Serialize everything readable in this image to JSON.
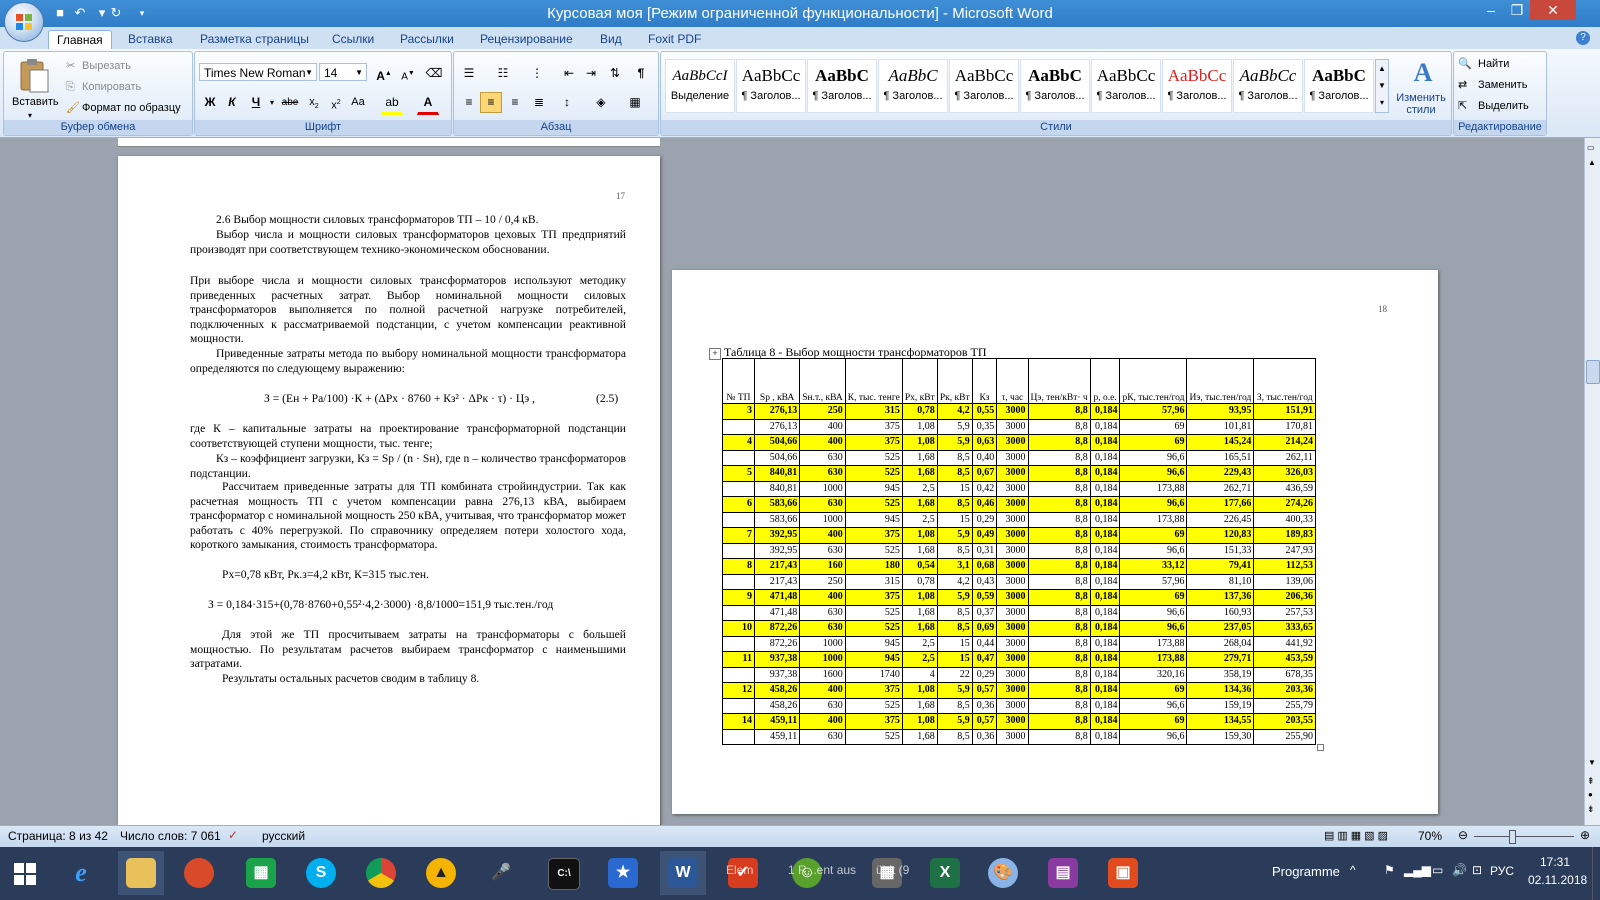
{
  "window": {
    "title": "Курсовая моя [Режим ограниченной функциональности] - Microsoft Word"
  },
  "tabs": [
    "Главная",
    "Вставка",
    "Разметка страницы",
    "Ссылки",
    "Рассылки",
    "Рецензирование",
    "Вид",
    "Foxit PDF"
  ],
  "clipboard": {
    "paste": "Вставить",
    "cut": "Вырезать",
    "copy": "Копировать",
    "format_painter": "Формат по образцу",
    "label": "Буфер обмена"
  },
  "font": {
    "name": "Times New Roman",
    "size": "14",
    "label": "Шрифт"
  },
  "paragraph": {
    "label": "Абзац"
  },
  "styles": {
    "label": "Стили",
    "items": [
      {
        "sample": "AaBbCcI",
        "name": "Выделение"
      },
      {
        "sample": "AaBbCc",
        "name": "¶ Заголов..."
      },
      {
        "sample": "AaBbC",
        "name": "¶ Заголов..."
      },
      {
        "sample": "AaBbC",
        "name": "¶ Заголов..."
      },
      {
        "sample": "AaBbCc",
        "name": "¶ Заголов..."
      },
      {
        "sample": "AaBbC",
        "name": "¶ Заголов..."
      },
      {
        "sample": "AaBbCc",
        "name": "¶ Заголов..."
      },
      {
        "sample": "AaBbCc",
        "name": "¶ Заголов..."
      },
      {
        "sample": "AaBbCc",
        "name": "¶ Заголов..."
      },
      {
        "sample": "AaBbC",
        "name": "¶ Заголов..."
      }
    ],
    "change": "Изменить стили"
  },
  "editing": {
    "label": "Редактирование",
    "find": "Найти",
    "replace": "Заменить",
    "select": "Выделить"
  },
  "page1": {
    "number": "17",
    "heading": "2.6  Выбор мощности силовых трансформаторов ТП – 10 / 0,4 кВ.",
    "para1": "Выбор числа и мощности силовых трансформаторов цеховых ТП предприятий производят при соответствующем технико-экономическом обосновании.",
    "para2": "При выборе числа и мощности силовых трансформаторов используют методику приведенных расчетных затрат. Выбор номинальной мощности силовых трансформаторов выполняется по полной расчетной нагрузке потребителей, подключенных к рассматриваемой подстанции, с учетом компенсации реактивной мощности.",
    "para3": "Приведенные затраты метода по выбору номинальной мощности трансформатора определяются по следующему выражению:",
    "formula": "З = (Ен  + Ра/100) ·К +  (ΔРх  · 8760 + Кз² ·  ΔРк  · τ) · Цэ ,",
    "formula_num": "(2.5)",
    "para4": "где  К  –  капитальные  затраты  на  проектирование  трансформаторной подстанции соответствующей ступени мощности, тыс. тенге;",
    "para5": "Кз  –  коэффициент  загрузки,  Кз  =  Sр  /  (n  ·  Sн),  где  n  –  количество трансформаторов подстанции.",
    "para6": "Рассчитаем приведенные затраты для ТП комбината стройиндустрии. Так как расчетная мощность ТП с учетом компенсации равна 276,13 кВА, выбираем трансформатор с номинальной мощность 250 кВА, учитывая, что трансформатор может работать с 40% перегрузкой. По справочнику определяем потери холостого хода, короткого замыкания, стоимость трансформатора.",
    "params": "Рх=0,78 кВт,  Рк.з=4,2 кВт,  К=315 тыс.тен.",
    "calc": "З = 0,184·315+(0,78·8760+0,55²·4,2·3000) ·8,8/1000=151,9 тыс.тен./год",
    "para7": "Для этой же ТП просчитываем затраты на трансформаторы с большей мощностью. По результатам расчетов выбираем трансформатор с наименьшими затратами.",
    "para8": "Результаты остальных расчетов сводим в таблицу 8."
  },
  "page2": {
    "number": "18",
    "caption": "Таблица 8 - Выбор мощности трансформаторов ТП",
    "headers": [
      "№ ТП",
      "Sр ,  кВА",
      "Sн.т., кВА",
      "К, тыс. тенге",
      "Рх, кВт",
      "Рк, кВт",
      "Кз",
      "τ, час",
      "Цэ, тен/кВт· ч",
      "р, о.е.",
      "рК, тыс.тен/год",
      "Иэ, тыс.тен/год",
      "З, тыс.тен/год"
    ],
    "rows": [
      {
        "hl": true,
        "cells": [
          "3",
          "276,13",
          "250",
          "315",
          "0,78",
          "4,2",
          "0,55",
          "3000",
          "8,8",
          "0,184",
          "57,96",
          "93,95",
          "151,91"
        ]
      },
      {
        "hl": false,
        "cells": [
          "",
          "276,13",
          "400",
          "375",
          "1,08",
          "5,9",
          "0,35",
          "3000",
          "8,8",
          "0,184",
          "69",
          "101,81",
          "170,81"
        ]
      },
      {
        "hl": true,
        "cells": [
          "4",
          "504,66",
          "400",
          "375",
          "1,08",
          "5,9",
          "0,63",
          "3000",
          "8,8",
          "0,184",
          "69",
          "145,24",
          "214,24"
        ]
      },
      {
        "hl": false,
        "cells": [
          "",
          "504,66",
          "630",
          "525",
          "1,68",
          "8,5",
          "0,40",
          "3000",
          "8,8",
          "0,184",
          "96,6",
          "165,51",
          "262,11"
        ]
      },
      {
        "hl": true,
        "cells": [
          "5",
          "840,81",
          "630",
          "525",
          "1,68",
          "8,5",
          "0,67",
          "3000",
          "8,8",
          "0,184",
          "96,6",
          "229,43",
          "326,03"
        ]
      },
      {
        "hl": false,
        "cells": [
          "",
          "840,81",
          "1000",
          "945",
          "2,5",
          "15",
          "0,42",
          "3000",
          "8,8",
          "0,184",
          "173,88",
          "262,71",
          "436,59"
        ]
      },
      {
        "hl": true,
        "cells": [
          "6",
          "583,66",
          "630",
          "525",
          "1,68",
          "8,5",
          "0,46",
          "3000",
          "8,8",
          "0,184",
          "96,6",
          "177,66",
          "274,26"
        ]
      },
      {
        "hl": false,
        "cells": [
          "",
          "583,66",
          "1000",
          "945",
          "2,5",
          "15",
          "0,29",
          "3000",
          "8,8",
          "0,184",
          "173,88",
          "226,45",
          "400,33"
        ]
      },
      {
        "hl": true,
        "cells": [
          "7",
          "392,95",
          "400",
          "375",
          "1,08",
          "5,9",
          "0,49",
          "3000",
          "8,8",
          "0,184",
          "69",
          "120,83",
          "189,83"
        ]
      },
      {
        "hl": false,
        "cells": [
          "",
          "392,95",
          "630",
          "525",
          "1,68",
          "8,5",
          "0,31",
          "3000",
          "8,8",
          "0,184",
          "96,6",
          "151,33",
          "247,93"
        ]
      },
      {
        "hl": true,
        "cells": [
          "8",
          "217,43",
          "160",
          "180",
          "0,54",
          "3,1",
          "0,68",
          "3000",
          "8,8",
          "0,184",
          "33,12",
          "79,41",
          "112,53"
        ]
      },
      {
        "hl": false,
        "cells": [
          "",
          "217,43",
          "250",
          "315",
          "0,78",
          "4,2",
          "0,43",
          "3000",
          "8,8",
          "0,184",
          "57,96",
          "81,10",
          "139,06"
        ]
      },
      {
        "hl": true,
        "cells": [
          "9",
          "471,48",
          "400",
          "375",
          "1,08",
          "5,9",
          "0,59",
          "3000",
          "8,8",
          "0,184",
          "69",
          "137,36",
          "206,36"
        ]
      },
      {
        "hl": false,
        "cells": [
          "",
          "471,48",
          "630",
          "525",
          "1,68",
          "8,5",
          "0,37",
          "3000",
          "8,8",
          "0,184",
          "96,6",
          "160,93",
          "257,53"
        ]
      },
      {
        "hl": true,
        "cells": [
          "10",
          "872,26",
          "630",
          "525",
          "1,68",
          "8,5",
          "0,69",
          "3000",
          "8,8",
          "0,184",
          "96,6",
          "237,05",
          "333,65"
        ]
      },
      {
        "hl": false,
        "cells": [
          "",
          "872,26",
          "1000",
          "945",
          "2,5",
          "15",
          "0,44",
          "3000",
          "8,8",
          "0,184",
          "173,88",
          "268,04",
          "441,92"
        ]
      },
      {
        "hl": true,
        "cells": [
          "11",
          "937,38",
          "1000",
          "945",
          "2,5",
          "15",
          "0,47",
          "3000",
          "8,8",
          "0,184",
          "173,88",
          "279,71",
          "453,59"
        ]
      },
      {
        "hl": false,
        "cells": [
          "",
          "937,38",
          "1600",
          "1740",
          "4",
          "22",
          "0,29",
          "3000",
          "8,8",
          "0,184",
          "320,16",
          "358,19",
          "678,35"
        ]
      },
      {
        "hl": true,
        "cells": [
          "12",
          "458,26",
          "400",
          "375",
          "1,08",
          "5,9",
          "0,57",
          "3000",
          "8,8",
          "0,184",
          "69",
          "134,36",
          "203,36"
        ]
      },
      {
        "hl": false,
        "cells": [
          "",
          "458,26",
          "630",
          "525",
          "1,68",
          "8,5",
          "0,36",
          "3000",
          "8,8",
          "0,184",
          "96,6",
          "159,19",
          "255,79"
        ]
      },
      {
        "hl": true,
        "cells": [
          "14",
          "459,11",
          "400",
          "375",
          "1,08",
          "5,9",
          "0,57",
          "3000",
          "8,8",
          "0,184",
          "69",
          "134,55",
          "203,55"
        ]
      },
      {
        "hl": false,
        "cells": [
          "",
          "459,11",
          "630",
          "525",
          "1,68",
          "8,5",
          "0,36",
          "3000",
          "8,8",
          "0,184",
          "96,6",
          "159,30",
          "255,90"
        ]
      }
    ]
  },
  "statusbar": {
    "page": "Страница: 8 из 42",
    "words": "Число слов: 7 061",
    "lang": "русский",
    "zoom": "70%"
  },
  "taskbar": {
    "programme": "Programme",
    "lang": "РУС",
    "time": "17:31",
    "date": "02.11.2018",
    "elem_label": "Elem",
    "rutgers": "1 R...ent aus",
    "excel_frag": "ühlt (9"
  }
}
